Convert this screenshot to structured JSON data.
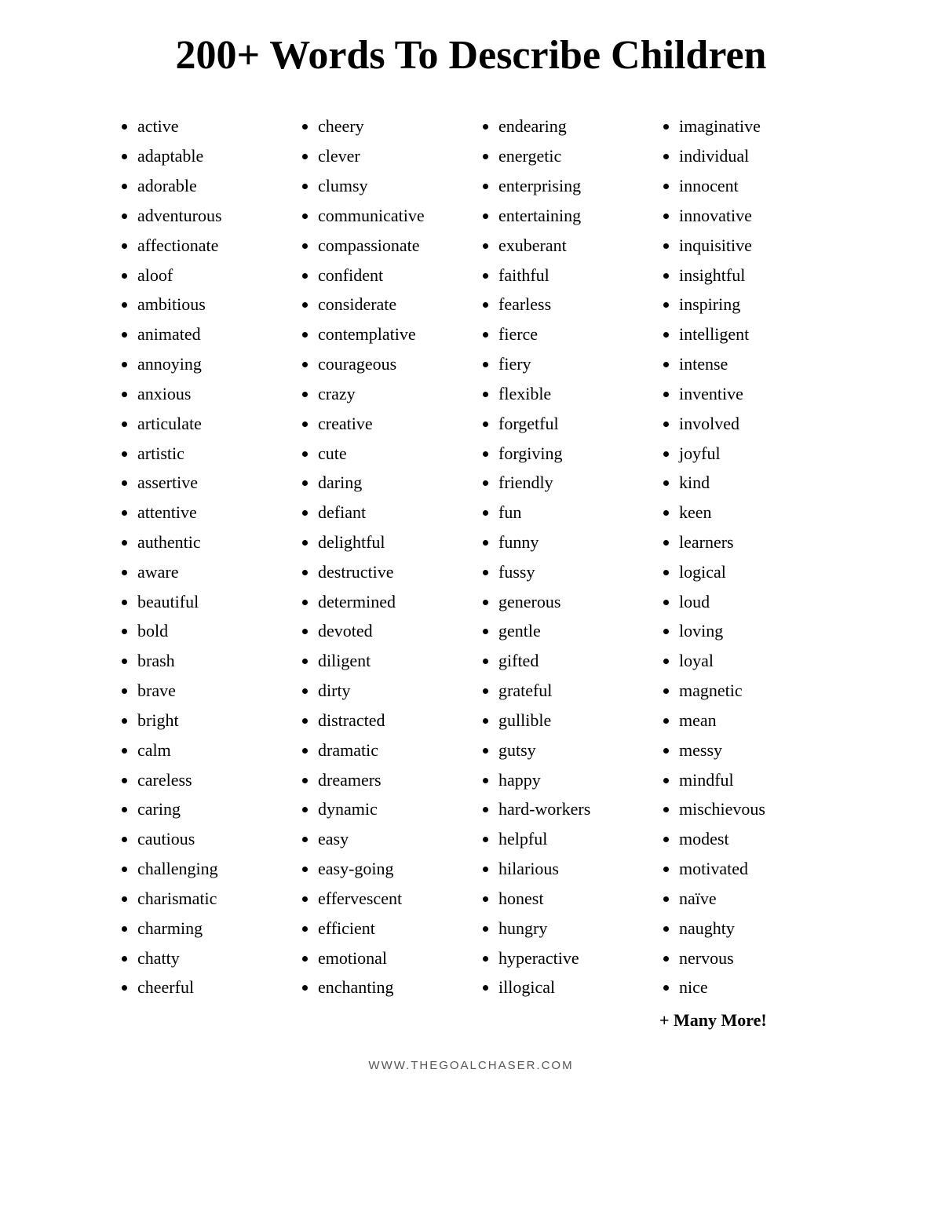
{
  "title": "200+ Words To Describe Children",
  "columns": [
    {
      "id": "col1",
      "words": [
        "active",
        "adaptable",
        "adorable",
        "adventurous",
        "affectionate",
        "aloof",
        "ambitious",
        "animated",
        "annoying",
        "anxious",
        "articulate",
        "artistic",
        "assertive",
        "attentive",
        "authentic",
        "aware",
        "beautiful",
        "bold",
        "brash",
        "brave",
        "bright",
        "calm",
        "careless",
        "caring",
        "cautious",
        "challenging",
        "charismatic",
        "charming",
        "chatty",
        "cheerful"
      ]
    },
    {
      "id": "col2",
      "words": [
        "cheery",
        "clever",
        "clumsy",
        "communicative",
        "compassionate",
        "confident",
        "considerate",
        "contemplative",
        "courageous",
        "crazy",
        "creative",
        "cute",
        "daring",
        "defiant",
        "delightful",
        "destructive",
        "determined",
        "devoted",
        "diligent",
        "dirty",
        "distracted",
        "dramatic",
        "dreamers",
        "dynamic",
        "easy",
        "easy-going",
        "effervescent",
        "efficient",
        "emotional",
        "enchanting"
      ]
    },
    {
      "id": "col3",
      "words": [
        "endearing",
        "energetic",
        "enterprising",
        "entertaining",
        "exuberant",
        "faithful",
        "fearless",
        "fierce",
        "fiery",
        "flexible",
        "forgetful",
        "forgiving",
        "friendly",
        "fun",
        "funny",
        "fussy",
        "generous",
        "gentle",
        "gifted",
        "grateful",
        "gullible",
        "gutsy",
        "happy",
        "hard-workers",
        "helpful",
        "hilarious",
        "honest",
        "hungry",
        "hyperactive",
        "illogical"
      ]
    },
    {
      "id": "col4",
      "words": [
        "imaginative",
        "individual",
        "innocent",
        "innovative",
        "inquisitive",
        "insightful",
        "inspiring",
        "intelligent",
        "intense",
        "inventive",
        "involved",
        "joyful",
        "kind",
        "keen",
        "learners",
        "logical",
        "loud",
        "loving",
        "loyal",
        "magnetic",
        "mean",
        "messy",
        "mindful",
        "mischievous",
        "modest",
        "motivated",
        "naïve",
        "naughty",
        "nervous",
        "nice"
      ],
      "extra": "+ Many More!"
    }
  ],
  "footer": "WWW.THEGOALCHASER.COM"
}
